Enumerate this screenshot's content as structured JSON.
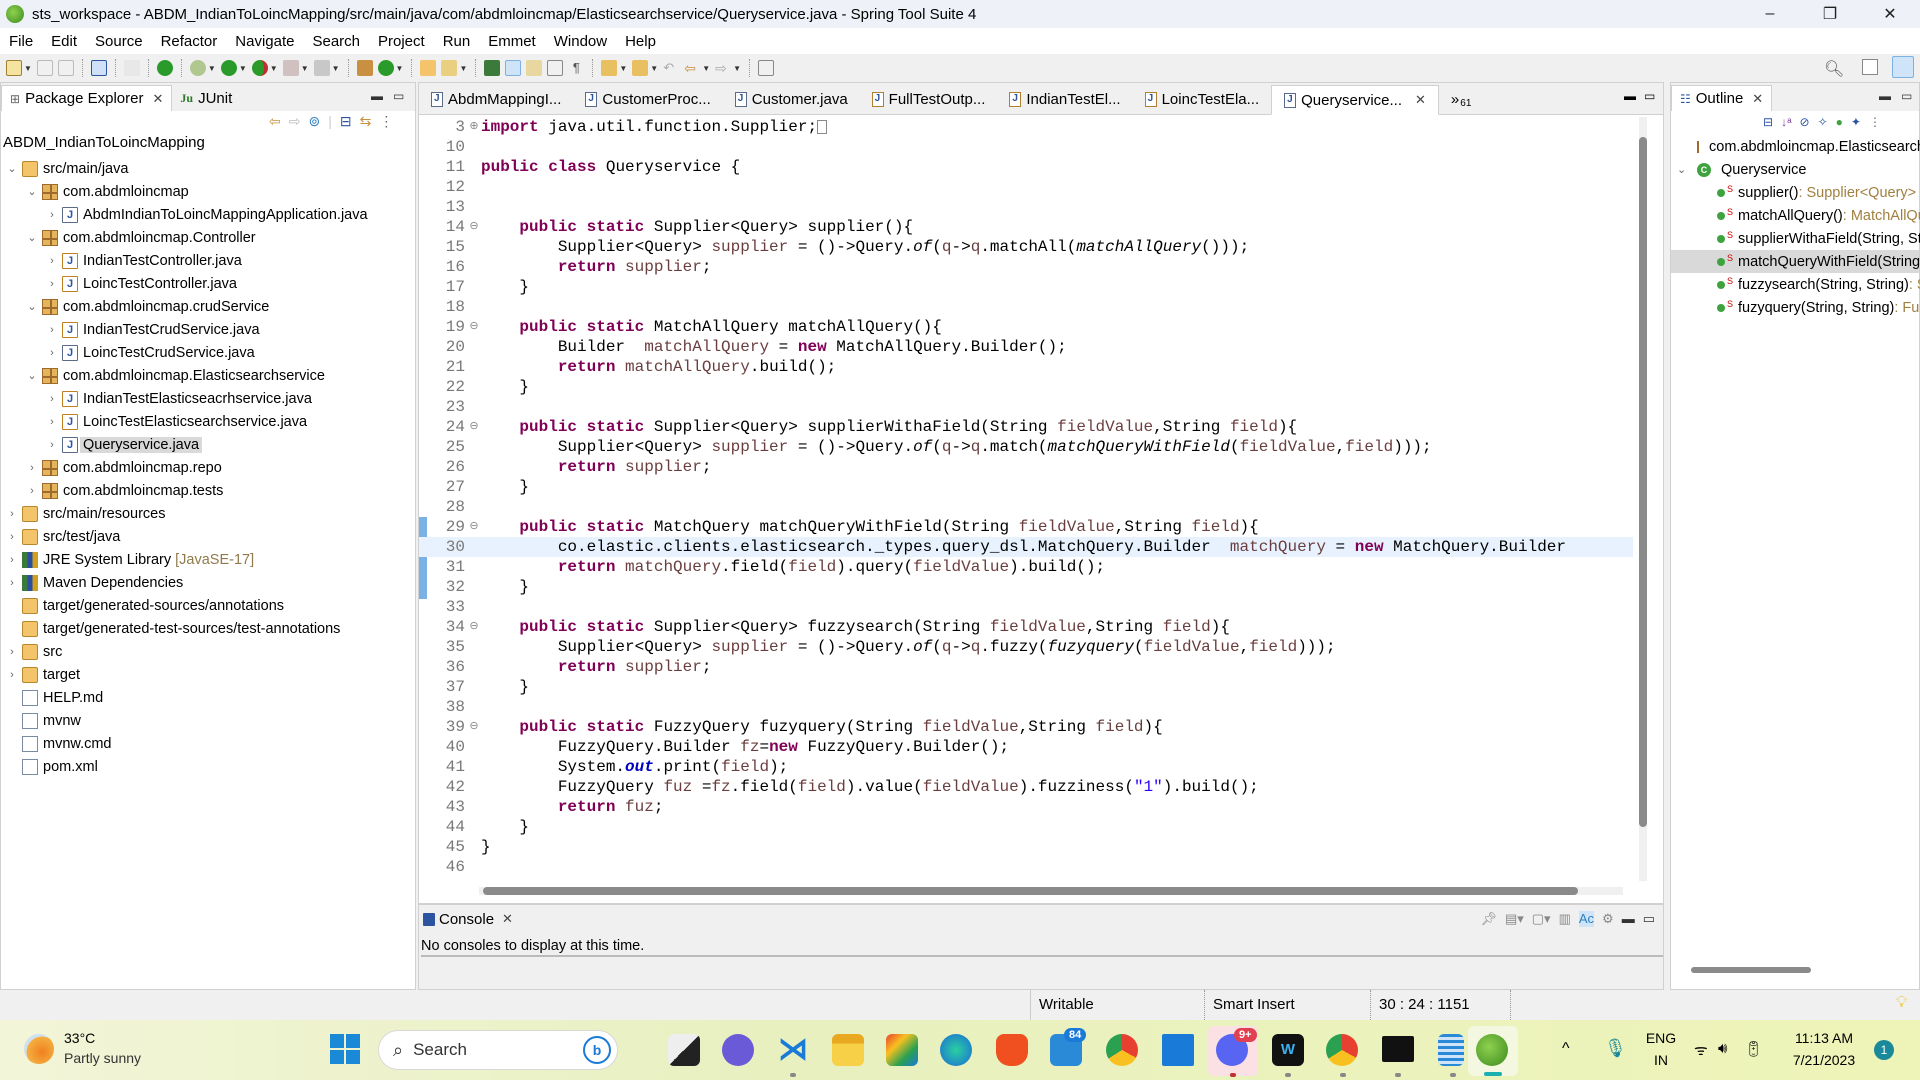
{
  "window": {
    "title": "sts_workspace - ABDM_IndianToLoincMapping/src/main/java/com/abdmloincmap/Elasticsearchservice/Queryservice.java - Spring Tool Suite 4",
    "minimize_label": "–",
    "restore_label": "❐",
    "close_label": "✕"
  },
  "menu": [
    "File",
    "Edit",
    "Source",
    "Refactor",
    "Navigate",
    "Search",
    "Project",
    "Run",
    "Emmet",
    "Window",
    "Help"
  ],
  "package_explorer": {
    "tab_label": "Package Explorer",
    "junit_tab_label": "JUnit",
    "junit_icon_text": "Ju",
    "project_name": "ABDM_IndianToLoincMapping",
    "tree": [
      {
        "label": "src/main/java",
        "level": 0,
        "twisty": "⌄",
        "icon": "src-folder"
      },
      {
        "label": "com.abdmloincmap",
        "level": 1,
        "twisty": "⌄",
        "icon": "package"
      },
      {
        "label": "AbdmIndianToLoincMappingApplication.java",
        "level": 2,
        "twisty": "›",
        "icon": "java-file"
      },
      {
        "label": "com.abdmloincmap.Controller",
        "level": 1,
        "twisty": "⌄",
        "icon": "package"
      },
      {
        "label": "IndianTestController.java",
        "level": 2,
        "twisty": "›",
        "icon": "java-file-warning"
      },
      {
        "label": "LoincTestController.java",
        "level": 2,
        "twisty": "›",
        "icon": "java-file-warning"
      },
      {
        "label": "com.abdmloincmap.crudService",
        "level": 1,
        "twisty": "⌄",
        "icon": "package"
      },
      {
        "label": "IndianTestCrudService.java",
        "level": 2,
        "twisty": "›",
        "icon": "java-file-warning"
      },
      {
        "label": "LoincTestCrudService.java",
        "level": 2,
        "twisty": "›",
        "icon": "java-file"
      },
      {
        "label": "com.abdmloincmap.Elasticsearchservice",
        "level": 1,
        "twisty": "⌄",
        "icon": "package"
      },
      {
        "label": "IndianTestElasticseacrhservice.java",
        "level": 2,
        "twisty": "›",
        "icon": "java-file-warning"
      },
      {
        "label": "LoincTestElasticsearchservice.java",
        "level": 2,
        "twisty": "›",
        "icon": "java-file-warning"
      },
      {
        "label": "Queryservice.java",
        "level": 2,
        "twisty": "›",
        "icon": "java-file",
        "selected": true
      },
      {
        "label": "com.abdmloincmap.repo",
        "level": 1,
        "twisty": "›",
        "icon": "package"
      },
      {
        "label": "com.abdmloincmap.tests",
        "level": 1,
        "twisty": "›",
        "icon": "package"
      },
      {
        "label": "src/main/resources",
        "level": 0,
        "twisty": "›",
        "icon": "src-folder"
      },
      {
        "label": "src/test/java",
        "level": 0,
        "twisty": "›",
        "icon": "src-folder"
      },
      {
        "label": "JRE System Library",
        "suffix": "[JavaSE-17]",
        "level": 0,
        "twisty": "›",
        "icon": "library"
      },
      {
        "label": "Maven Dependencies",
        "level": 0,
        "twisty": "›",
        "icon": "library"
      },
      {
        "label": "target/generated-sources/annotations",
        "level": 0,
        "twisty": "",
        "icon": "src-folder"
      },
      {
        "label": "target/generated-test-sources/test-annotations",
        "level": 0,
        "twisty": "",
        "icon": "src-folder"
      },
      {
        "label": "src",
        "level": 0,
        "twisty": "›",
        "icon": "folder"
      },
      {
        "label": "target",
        "level": 0,
        "twisty": "›",
        "icon": "folder"
      },
      {
        "label": "HELP.md",
        "level": 0,
        "twisty": "",
        "icon": "file"
      },
      {
        "label": "mvnw",
        "level": 0,
        "twisty": "",
        "icon": "file"
      },
      {
        "label": "mvnw.cmd",
        "level": 0,
        "twisty": "",
        "icon": "file"
      },
      {
        "label": "pom.xml",
        "level": 0,
        "twisty": "",
        "icon": "file"
      }
    ]
  },
  "editor": {
    "tabs": [
      {
        "label": "AbdmMappingI...",
        "warn": false
      },
      {
        "label": "CustomerProc...",
        "warn": false
      },
      {
        "label": "Customer.java",
        "warn": false
      },
      {
        "label": "FullTestOutp...",
        "warn": true
      },
      {
        "label": "IndianTestEl...",
        "warn": true
      },
      {
        "label": "LoincTestEla...",
        "warn": true
      },
      {
        "label": "Queryservice...",
        "warn": false,
        "active": true
      }
    ],
    "overflow_label": "»",
    "overflow_count": "61",
    "highlighted_line": "30",
    "lines": [
      {
        "n": "3",
        "fold": "⊕",
        "html": "<span class='kw'>import</span> java.util.function.Supplier;<span style='border:1px solid #888;display:inline-block;width:10px;height:14px;vertical-align:middle'></span>"
      },
      {
        "n": "10",
        "fold": "",
        "html": ""
      },
      {
        "n": "11",
        "fold": "",
        "html": "<span class='kw'>public</span> <span class='kw'>class</span> Queryservice {"
      },
      {
        "n": "12",
        "fold": "",
        "html": ""
      },
      {
        "n": "13",
        "fold": "",
        "html": ""
      },
      {
        "n": "14",
        "fold": "⊖",
        "html": "    <span class='kw'>public</span> <span class='kw'>static</span> Supplier&lt;Query&gt; supplier(){"
      },
      {
        "n": "15",
        "fold": "",
        "html": "        Supplier&lt;Query&gt; <span class='var'>supplier</span> = ()-&gt;Query.<span class='it'>of</span>(<span class='var'>q</span>-&gt;<span class='var'>q</span>.matchAll(<span class='it'>matchAllQuery</span>()));"
      },
      {
        "n": "16",
        "fold": "",
        "html": "        <span class='kw'>return</span> <span class='var'>supplier</span>;"
      },
      {
        "n": "17",
        "fold": "",
        "html": "    }"
      },
      {
        "n": "18",
        "fold": "",
        "html": ""
      },
      {
        "n": "19",
        "fold": "⊖",
        "html": "    <span class='kw'>public</span> <span class='kw'>static</span> MatchAllQuery matchAllQuery(){"
      },
      {
        "n": "20",
        "fold": "",
        "html": "        Builder  <span class='var'>matchAllQuery</span> = <span class='kw'>new</span> MatchAllQuery.Builder();"
      },
      {
        "n": "21",
        "fold": "",
        "html": "        <span class='kw'>return</span> <span class='var'>matchAllQuery</span>.build();"
      },
      {
        "n": "22",
        "fold": "",
        "html": "    }"
      },
      {
        "n": "23",
        "fold": "",
        "html": ""
      },
      {
        "n": "24",
        "fold": "⊖",
        "html": "    <span class='kw'>public</span> <span class='kw'>static</span> Supplier&lt;Query&gt; supplierWithaField(String <span class='var'>fieldValue</span>,String <span class='var'>field</span>){"
      },
      {
        "n": "25",
        "fold": "",
        "html": "        Supplier&lt;Query&gt; <span class='var'>supplier</span> = ()-&gt;Query.<span class='it'>of</span>(<span class='var'>q</span>-&gt;<span class='var'>q</span>.match(<span class='it'>matchQueryWithField</span>(<span class='var'>fieldValue</span>,<span class='var'>field</span>)));"
      },
      {
        "n": "26",
        "fold": "",
        "html": "        <span class='kw'>return</span> <span class='var'>supplier</span>;"
      },
      {
        "n": "27",
        "fold": "",
        "html": "    }"
      },
      {
        "n": "28",
        "fold": "",
        "html": ""
      },
      {
        "n": "29",
        "fold": "⊖",
        "html": "    <span class='kw'>public</span> <span class='kw'>static</span> MatchQuery matchQueryWithField(String <span class='var'>fieldValue</span>,String <span class='var'>field</span>){"
      },
      {
        "n": "30",
        "fold": "",
        "html": "        co.elastic.clients.elasticsearch._types.query_dsl.MatchQuery.Builder  <span class='var'>matchQuery</span> = <span class='kw'>new</span> MatchQuery.Builder"
      },
      {
        "n": "31",
        "fold": "",
        "html": "        <span class='kw'>return</span> <span class='var'>matchQuery</span>.field(<span class='var'>field</span>).query(<span class='var'>fieldValue</span>).build();"
      },
      {
        "n": "32",
        "fold": "",
        "html": "    }"
      },
      {
        "n": "33",
        "fold": "",
        "html": ""
      },
      {
        "n": "34",
        "fold": "⊖",
        "html": "    <span class='kw'>public</span> <span class='kw'>static</span> Supplier&lt;Query&gt; fuzzysearch(String <span class='var'>fieldValue</span>,String <span class='var'>field</span>){"
      },
      {
        "n": "35",
        "fold": "",
        "html": "        Supplier&lt;Query&gt; <span class='var'>supplier</span> = ()-&gt;Query.<span class='it'>of</span>(<span class='var'>q</span>-&gt;<span class='var'>q</span>.fuzzy(<span class='it'>fuzyquery</span>(<span class='var'>fieldValue</span>,<span class='var'>field</span>)));"
      },
      {
        "n": "36",
        "fold": "",
        "html": "        <span class='kw'>return</span> <span class='var'>supplier</span>;"
      },
      {
        "n": "37",
        "fold": "",
        "html": "    }"
      },
      {
        "n": "38",
        "fold": "",
        "html": ""
      },
      {
        "n": "39",
        "fold": "⊖",
        "html": "    <span class='kw'>public</span> <span class='kw'>static</span> FuzzyQuery fuzyquery(String <span class='var'>fieldValue</span>,String <span class='var'>field</span>){"
      },
      {
        "n": "40",
        "fold": "",
        "html": "        FuzzyQuery.Builder <span class='var'>fz</span>=<span class='kw'>new</span> FuzzyQuery.Builder();"
      },
      {
        "n": "41",
        "fold": "",
        "html": "        System.<span class='fld'>out</span>.print(<span class='var'>field</span>);"
      },
      {
        "n": "42",
        "fold": "",
        "html": "        FuzzyQuery <span class='var'>fuz</span> =<span class='var'>fz</span>.field(<span class='var'>field</span>).value(<span class='var'>fieldValue</span>).fuzziness(<span class='str'>\"1\"</span>).build();"
      },
      {
        "n": "43",
        "fold": "",
        "html": "        <span class='kw'>return</span> <span class='var'>fuz</span>;"
      },
      {
        "n": "44",
        "fold": "",
        "html": "    }"
      },
      {
        "n": "45",
        "fold": "",
        "html": "}"
      },
      {
        "n": "46",
        "fold": "",
        "html": ""
      }
    ]
  },
  "console": {
    "tab_label": "Console",
    "message": "No consoles to display at this time."
  },
  "outline": {
    "tab_label": "Outline",
    "package": "com.abdmloincmap.Elasticsearchservice",
    "class_name": "Queryservice",
    "members": [
      {
        "name": "supplier()",
        "ret": " : Supplier<Query>"
      },
      {
        "name": "matchAllQuery()",
        "ret": " : MatchAllQuery"
      },
      {
        "name": "supplierWithaField(String, String)",
        "ret": " : Supplier<Query>"
      },
      {
        "name": "matchQueryWithField(String, String)",
        "ret": " : MatchQuery",
        "selected": true
      },
      {
        "name": "fuzzysearch(String, String)",
        "ret": " : Supplier<Query>"
      },
      {
        "name": "fuzyquery(String, String)",
        "ret": " : FuzzyQuery"
      }
    ],
    "static_marker": "S"
  },
  "status": {
    "writable": "Writable",
    "insert_mode": "Smart Insert",
    "position": "30 : 24 : 1151"
  },
  "taskbar": {
    "weather_temp": "33°C",
    "weather_desc": "Partly sunny",
    "search_placeholder": "Search",
    "mail_badge": "84",
    "discord_badge": "9+",
    "language": "ENG",
    "region": "IN",
    "time": "11:13 AM",
    "date": "7/21/2023",
    "notification_count": "1"
  }
}
